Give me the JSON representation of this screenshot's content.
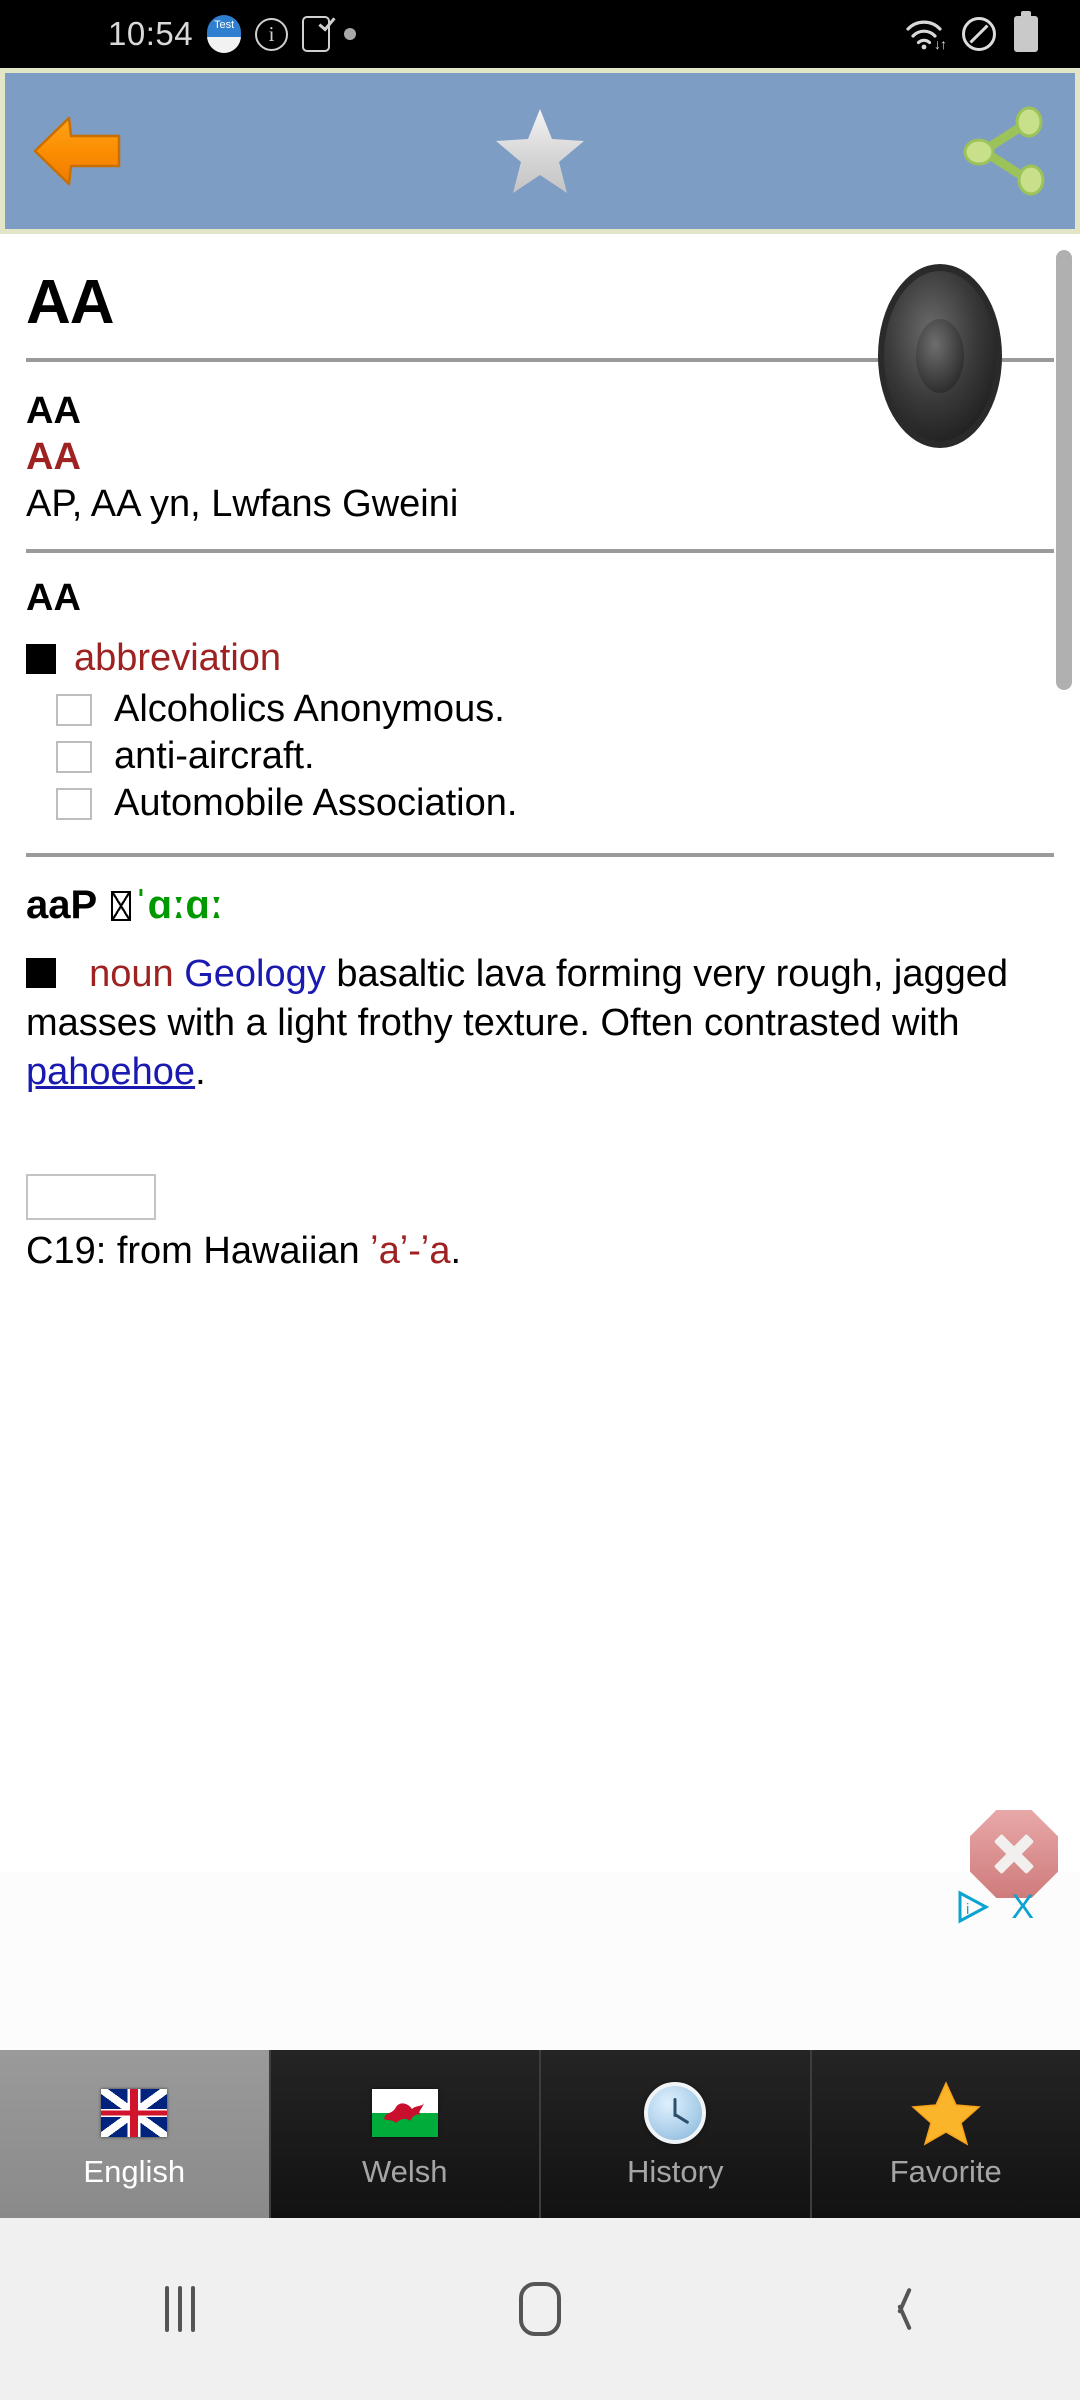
{
  "status_bar": {
    "clock": "10:54",
    "left_icons": [
      "test-app-icon",
      "info-circle-icon",
      "phone-check-icon",
      "dot-icon"
    ],
    "right_icons": [
      "wifi-icon",
      "do-not-disturb-icon",
      "battery-icon"
    ]
  },
  "toolbar": {
    "back_icon": "back-arrow-icon",
    "favorite_icon": "star-icon",
    "share_icon": "share-icon"
  },
  "entry": {
    "headword": "AA",
    "speaker_icon": "speaker-icon",
    "welsh_block": {
      "term": "AA",
      "term_red": "AA",
      "translation": "AP, AA yn, Lwfans Gweini"
    },
    "abbrev_block": {
      "term": "AA",
      "pos": "abbreviation",
      "senses": [
        "Alcoholics Anonymous.",
        "anti-aircraft.",
        "Automobile Association."
      ]
    },
    "noun_block": {
      "word": "aaP",
      "phonetic": "ˈɑːɑː",
      "pos": "noun",
      "field": "Geology",
      "definition_part1": "basaltic lava forming very rough, jagged masses with a light frothy texture. Often contrasted with ",
      "xref": "pahoehoe",
      "definition_part2": ".",
      "etymology_prefix": "C19: from Hawaiian ",
      "etymology_term": "ʼaʼ-ʼa",
      "etymology_suffix": "."
    }
  },
  "ad": {
    "close_icon": "ad-close-octagon-icon",
    "adchoices_icon": "adchoices-icon",
    "dismiss_label": "X"
  },
  "tabs": [
    {
      "label": "English",
      "icon": "uk-flag-icon",
      "active": true
    },
    {
      "label": "Welsh",
      "icon": "wales-flag-icon",
      "active": false
    },
    {
      "label": "History",
      "icon": "clock-icon",
      "active": false
    },
    {
      "label": "Favorite",
      "icon": "star-icon",
      "active": false
    }
  ],
  "nav_bar": {
    "recents": "recents-icon",
    "home": "home-icon",
    "back": "back-icon"
  },
  "colors": {
    "toolbar_bg": "#7d9dc4",
    "toolbar_border": "#e2e6c6",
    "accent_red": "#9e2222",
    "accent_blue": "#1a1ab0",
    "phonetic_green": "#009900",
    "tab_active_bg": "#9a9a9a"
  }
}
